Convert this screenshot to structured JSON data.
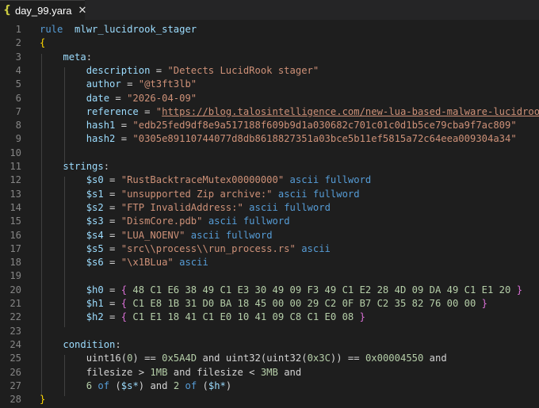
{
  "tab": {
    "icon": "{",
    "filename": "day_99.yara",
    "close_glyph": "✕"
  },
  "colors": {
    "keyword": "#569cd6",
    "identifier": "#9cdcfe",
    "string": "#ce9178",
    "number": "#b5cea8",
    "brace": "#ffd700"
  },
  "lines": [
    {
      "n": "1",
      "tokens": [
        [
          "kw",
          "rule"
        ],
        [
          "",
          "  "
        ],
        [
          "id",
          "mlwr_lucidrook_stager"
        ]
      ]
    },
    {
      "n": "2",
      "tokens": [
        [
          "brace",
          "{"
        ]
      ]
    },
    {
      "n": "3",
      "tokens": [
        [
          "",
          "    "
        ],
        [
          "id",
          "meta"
        ],
        [
          "",
          ":"
        ]
      ]
    },
    {
      "n": "4",
      "tokens": [
        [
          "",
          "        "
        ],
        [
          "id",
          "description"
        ],
        [
          "",
          " = "
        ],
        [
          "str",
          "\"Detects LucidRook stager\""
        ]
      ]
    },
    {
      "n": "5",
      "tokens": [
        [
          "",
          "        "
        ],
        [
          "id",
          "author"
        ],
        [
          "",
          " = "
        ],
        [
          "str",
          "\"@t3ft3lb\""
        ]
      ]
    },
    {
      "n": "6",
      "tokens": [
        [
          "",
          "        "
        ],
        [
          "id",
          "date"
        ],
        [
          "",
          " = "
        ],
        [
          "str",
          "\"2026-04-09\""
        ]
      ]
    },
    {
      "n": "7",
      "tokens": [
        [
          "",
          "        "
        ],
        [
          "id",
          "reference"
        ],
        [
          "",
          " = "
        ],
        [
          "str",
          "\""
        ],
        [
          "url",
          "https://blog.talosintelligence.com/new-lua-based-malware-lucidrook/"
        ],
        [
          "str",
          "\""
        ]
      ]
    },
    {
      "n": "8",
      "tokens": [
        [
          "",
          "        "
        ],
        [
          "id",
          "hash1"
        ],
        [
          "",
          " = "
        ],
        [
          "str",
          "\"edb25fed9df8e9a517188f609b9d1a030682c701c01c0d1b5ce79cba9f7ac809\""
        ]
      ]
    },
    {
      "n": "9",
      "tokens": [
        [
          "",
          "        "
        ],
        [
          "id",
          "hash2"
        ],
        [
          "",
          " = "
        ],
        [
          "str",
          "\"0305e89110744077d8db8618827351a03bce5b11ef5815a72c64eea009304a34\""
        ]
      ]
    },
    {
      "n": "10",
      "tokens": []
    },
    {
      "n": "11",
      "tokens": [
        [
          "",
          "    "
        ],
        [
          "id",
          "strings"
        ],
        [
          "",
          ":"
        ]
      ]
    },
    {
      "n": "12",
      "tokens": [
        [
          "",
          "        "
        ],
        [
          "id",
          "$s0"
        ],
        [
          "",
          " = "
        ],
        [
          "str",
          "\"RustBacktraceMutex00000000\""
        ],
        [
          "",
          " "
        ],
        [
          "kw",
          "ascii"
        ],
        [
          "",
          " "
        ],
        [
          "kw",
          "fullword"
        ]
      ]
    },
    {
      "n": "13",
      "tokens": [
        [
          "",
          "        "
        ],
        [
          "id",
          "$s1"
        ],
        [
          "",
          " = "
        ],
        [
          "str",
          "\"unsupported Zip archive:\""
        ],
        [
          "",
          " "
        ],
        [
          "kw",
          "ascii"
        ],
        [
          "",
          " "
        ],
        [
          "kw",
          "fullword"
        ]
      ]
    },
    {
      "n": "14",
      "tokens": [
        [
          "",
          "        "
        ],
        [
          "id",
          "$s2"
        ],
        [
          "",
          " = "
        ],
        [
          "str",
          "\"FTP InvalidAddress:\""
        ],
        [
          "",
          " "
        ],
        [
          "kw",
          "ascii"
        ],
        [
          "",
          " "
        ],
        [
          "kw",
          "fullword"
        ]
      ]
    },
    {
      "n": "15",
      "tokens": [
        [
          "",
          "        "
        ],
        [
          "id",
          "$s3"
        ],
        [
          "",
          " = "
        ],
        [
          "str",
          "\"DismCore.pdb\""
        ],
        [
          "",
          " "
        ],
        [
          "kw",
          "ascii"
        ],
        [
          "",
          " "
        ],
        [
          "kw",
          "fullword"
        ]
      ]
    },
    {
      "n": "16",
      "tokens": [
        [
          "",
          "        "
        ],
        [
          "id",
          "$s4"
        ],
        [
          "",
          " = "
        ],
        [
          "str",
          "\"LUA_NOENV\""
        ],
        [
          "",
          " "
        ],
        [
          "kw",
          "ascii"
        ],
        [
          "",
          " "
        ],
        [
          "kw",
          "fullword"
        ]
      ]
    },
    {
      "n": "17",
      "tokens": [
        [
          "",
          "        "
        ],
        [
          "id",
          "$s5"
        ],
        [
          "",
          " = "
        ],
        [
          "str",
          "\"src\\\\process\\\\run_process.rs\""
        ],
        [
          "",
          " "
        ],
        [
          "kw",
          "ascii"
        ]
      ]
    },
    {
      "n": "18",
      "tokens": [
        [
          "",
          "        "
        ],
        [
          "id",
          "$s6"
        ],
        [
          "",
          " = "
        ],
        [
          "str",
          "\"\\x1BLua\""
        ],
        [
          "",
          " "
        ],
        [
          "kw",
          "ascii"
        ]
      ]
    },
    {
      "n": "19",
      "tokens": []
    },
    {
      "n": "20",
      "tokens": [
        [
          "",
          "        "
        ],
        [
          "id",
          "$h0"
        ],
        [
          "",
          " = "
        ],
        [
          "brace2",
          "{"
        ],
        [
          "num",
          " 48 C1 E6 38 49 C1 E3 30 49 09 F3 49 C1 E2 28 4D 09 DA 49 C1 E1 20 "
        ],
        [
          "brace2",
          "}"
        ]
      ]
    },
    {
      "n": "21",
      "tokens": [
        [
          "",
          "        "
        ],
        [
          "id",
          "$h1"
        ],
        [
          "",
          " = "
        ],
        [
          "brace2",
          "{"
        ],
        [
          "num",
          " C1 E8 1B 31 D0 BA 18 45 00 00 29 C2 0F B7 C2 35 82 76 00 00 "
        ],
        [
          "brace2",
          "}"
        ]
      ]
    },
    {
      "n": "22",
      "tokens": [
        [
          "",
          "        "
        ],
        [
          "id",
          "$h2"
        ],
        [
          "",
          " = "
        ],
        [
          "brace2",
          "{"
        ],
        [
          "num",
          " C1 E1 18 41 C1 E0 10 41 09 C8 C1 E0 08 "
        ],
        [
          "brace2",
          "}"
        ]
      ]
    },
    {
      "n": "23",
      "tokens": []
    },
    {
      "n": "24",
      "tokens": [
        [
          "",
          "    "
        ],
        [
          "id",
          "condition"
        ],
        [
          "",
          ":"
        ]
      ]
    },
    {
      "n": "25",
      "tokens": [
        [
          "",
          "        "
        ],
        [
          "",
          "uint16("
        ],
        [
          "num",
          "0"
        ],
        [
          "",
          ") == "
        ],
        [
          "num",
          "0x5A4D"
        ],
        [
          "",
          " and uint32(uint32("
        ],
        [
          "num",
          "0x3C"
        ],
        [
          "",
          ")) == "
        ],
        [
          "num",
          "0x00004550"
        ],
        [
          "",
          " and"
        ]
      ]
    },
    {
      "n": "26",
      "tokens": [
        [
          "",
          "        filesize > "
        ],
        [
          "num",
          "1MB"
        ],
        [
          "",
          " and filesize < "
        ],
        [
          "num",
          "3MB"
        ],
        [
          "",
          " and"
        ]
      ]
    },
    {
      "n": "27",
      "tokens": [
        [
          "",
          "        "
        ],
        [
          "num",
          "6"
        ],
        [
          "",
          " "
        ],
        [
          "kw",
          "of"
        ],
        [
          "",
          " ("
        ],
        [
          "id",
          "$s*"
        ],
        [
          "",
          ") and "
        ],
        [
          "num",
          "2"
        ],
        [
          "",
          " "
        ],
        [
          "kw",
          "of"
        ],
        [
          "",
          " ("
        ],
        [
          "id",
          "$h*"
        ],
        [
          "",
          ")"
        ]
      ]
    },
    {
      "n": "28",
      "tokens": [
        [
          "brace",
          "}"
        ]
      ]
    }
  ]
}
